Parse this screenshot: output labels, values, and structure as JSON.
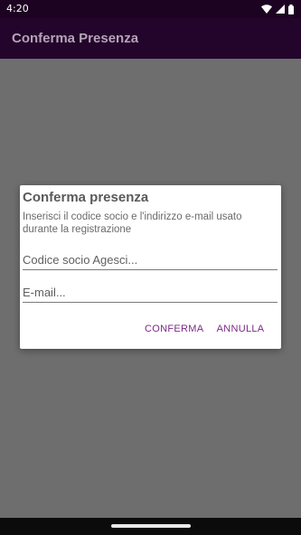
{
  "status_bar": {
    "time": "4:20",
    "icons": [
      "wifi-icon",
      "signal-icon",
      "battery-icon"
    ]
  },
  "app_bar": {
    "title": "Conferma Presenza"
  },
  "dialog": {
    "title": "Conferma presenza",
    "message": "Inserisci il codice socio e l'indirizzo e-mail usato durante la registrazione",
    "codice_field": {
      "value": "",
      "placeholder": "Codice socio Agesci..."
    },
    "email_field": {
      "value": "",
      "placeholder": "E-mail..."
    },
    "confirm_label": "CONFERMA",
    "cancel_label": "ANNULLA"
  },
  "colors": {
    "status_bar": "#1d0322",
    "app_bar": "#23042b",
    "scrim": "#6e6e6e",
    "accent": "#7b2a86"
  }
}
